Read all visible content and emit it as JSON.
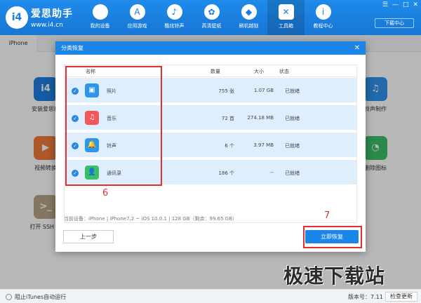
{
  "app": {
    "logo_text": "i4",
    "brand_name": "爱思助手",
    "brand_url": "www.i4.cn",
    "download_center": "下载中心",
    "win_controls": [
      "☰",
      "—",
      "□",
      "✕"
    ]
  },
  "nav": [
    {
      "label": "我的设备",
      "icon": "apple-icon",
      "glyph": ""
    },
    {
      "label": "应用游戏",
      "icon": "appstore-icon",
      "glyph": "A"
    },
    {
      "label": "酷炫铃声",
      "icon": "bell-icon",
      "glyph": "♪"
    },
    {
      "label": "高清壁纸",
      "icon": "flower-icon",
      "glyph": "✿"
    },
    {
      "label": "刷机越狱",
      "icon": "dropbox-icon",
      "glyph": "◆"
    },
    {
      "label": "工具箱",
      "icon": "tools-icon",
      "glyph": "✕"
    },
    {
      "label": "教程中心",
      "icon": "info-icon",
      "glyph": "i"
    }
  ],
  "tabs": {
    "device_tab": "iPhone"
  },
  "background_tools": [
    {
      "label": "安装爱思移",
      "color": "#1f7ee0",
      "glyph": "i4"
    },
    {
      "label": "视频转换",
      "color": "#f07a3b",
      "glyph": "▶"
    },
    {
      "label": "打开 SSH 通",
      "color": "#b8a486",
      "glyph": ">_"
    },
    {
      "label": "铃声制作",
      "color": "#2f92ec",
      "glyph": "♫"
    },
    {
      "label": "删除图标",
      "color": "#3cbf68",
      "glyph": "◔"
    }
  ],
  "dialog": {
    "title": "分类恢复",
    "close_glyph": "✕",
    "columns": {
      "name": "名称",
      "count": "数量",
      "size": "大小",
      "status": "状态"
    },
    "rows": [
      {
        "name": "照片",
        "count": "755 张",
        "size": "1.07 GB",
        "status": "已就绪",
        "icon": "photo-icon",
        "color": "#2e96ea",
        "glyph": "▣"
      },
      {
        "name": "音乐",
        "count": "72 首",
        "size": "274.18 MB",
        "status": "已就绪",
        "icon": "music-icon",
        "color": "#f0585a",
        "glyph": "♫"
      },
      {
        "name": "铃声",
        "count": "6 个",
        "size": "3.97 MB",
        "status": "已就绪",
        "icon": "bell-icon",
        "color": "#2e96ea",
        "glyph": "🔔"
      },
      {
        "name": "通讯录",
        "count": "186 个",
        "size": "--",
        "status": "已就绪",
        "icon": "contacts-icon",
        "color": "#3bbf65",
        "glyph": "👤"
      }
    ],
    "device_info": "当前设备：iPhone  |  iPhone7,2 ~ iOS 10.0.1  |  128 GB（剩余：99.65 GB）",
    "prev_button": "上一步",
    "restore_button": "立即恢复"
  },
  "annotations": {
    "step6": "6",
    "step7": "7"
  },
  "statusbar": {
    "block_itunes": "阻止iTunes自动运行",
    "version": "版本号：7.11",
    "check_update": "检查更新"
  },
  "watermark": "极速下载站"
}
